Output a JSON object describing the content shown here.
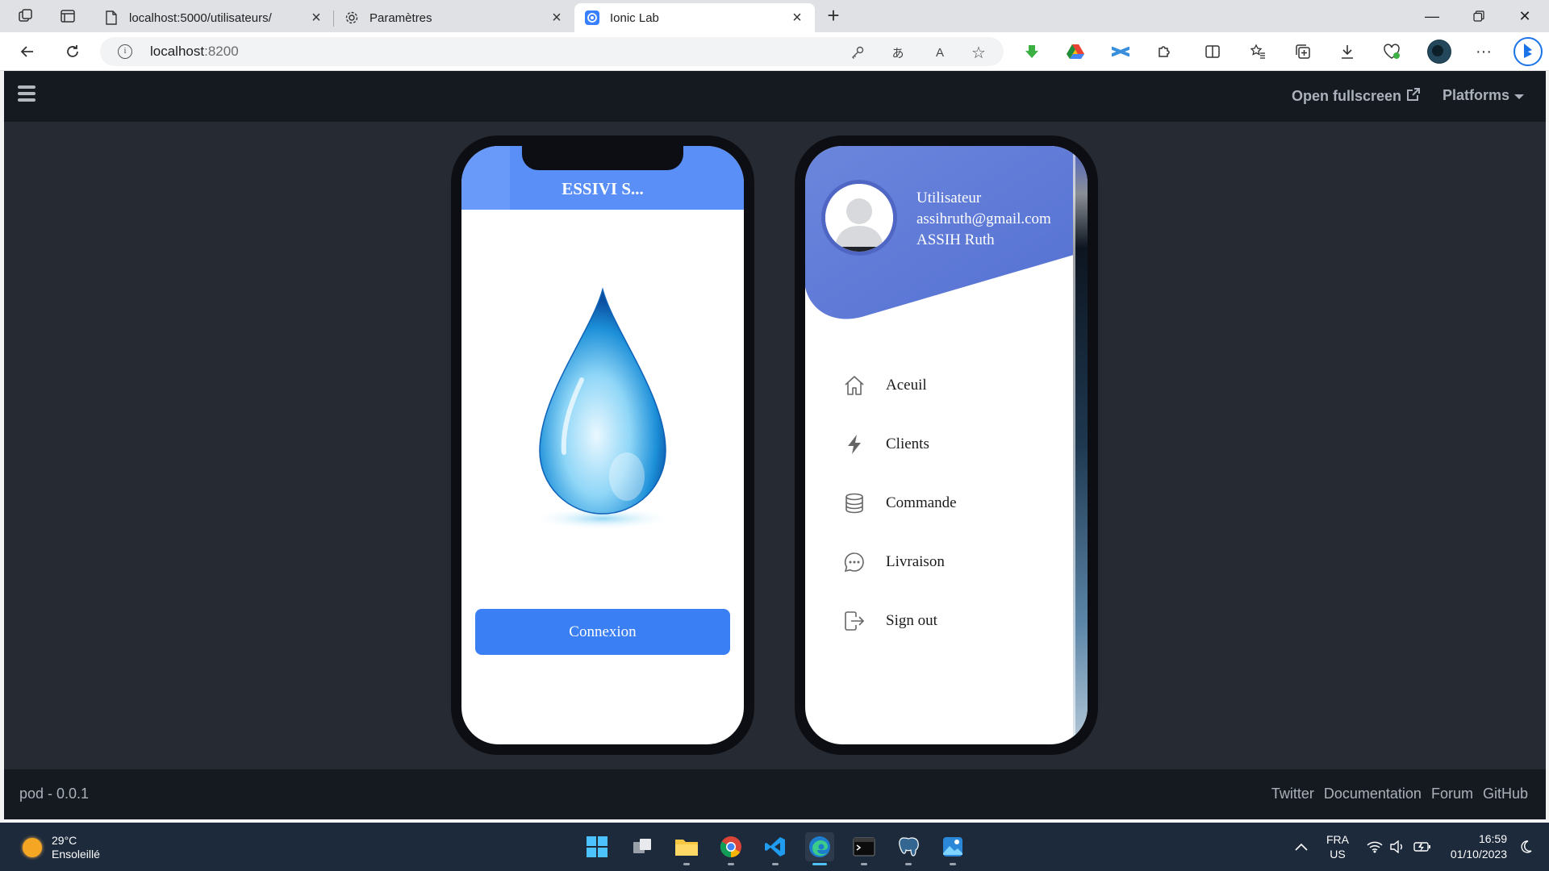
{
  "browser": {
    "tabs": [
      {
        "title": "localhost:5000/utilisateurs/",
        "icon": "page-icon",
        "active": false
      },
      {
        "title": "Paramètres",
        "icon": "gear-icon",
        "active": false
      },
      {
        "title": "Ionic Lab",
        "icon": "ionic-icon",
        "active": true
      }
    ],
    "url_host": "localhost",
    "url_port": ":8200"
  },
  "lab": {
    "header": {
      "fullscreen_label": "Open fullscreen",
      "platforms_label": "Platforms"
    },
    "footer": {
      "version": "pod - 0.0.1",
      "links": [
        "Twitter",
        "Documentation",
        "Forum",
        "GitHub"
      ]
    }
  },
  "phone_login": {
    "title": "ESSIVI S...",
    "button_label": "Connexion",
    "header_color": "#5a8ff8",
    "button_color": "#3b7ff5"
  },
  "phone_menu": {
    "user": {
      "role": "Utilisateur",
      "email": "assihruth@gmail.com",
      "name": "ASSIH Ruth"
    },
    "items": [
      {
        "label": "Aceuil",
        "icon": "home-icon"
      },
      {
        "label": "Clients",
        "icon": "flash-icon"
      },
      {
        "label": "Commande",
        "icon": "database-icon"
      },
      {
        "label": "Livraison",
        "icon": "chat-bubble-icon"
      },
      {
        "label": "Sign out",
        "icon": "log-out-icon"
      }
    ],
    "header_color": "#5b7fd8"
  },
  "taskbar": {
    "weather_temp": "29°C",
    "weather_desc": "Ensoleillé",
    "lang_top": "FRA",
    "lang_bottom": "US",
    "time": "16:59",
    "date": "01/10/2023"
  }
}
